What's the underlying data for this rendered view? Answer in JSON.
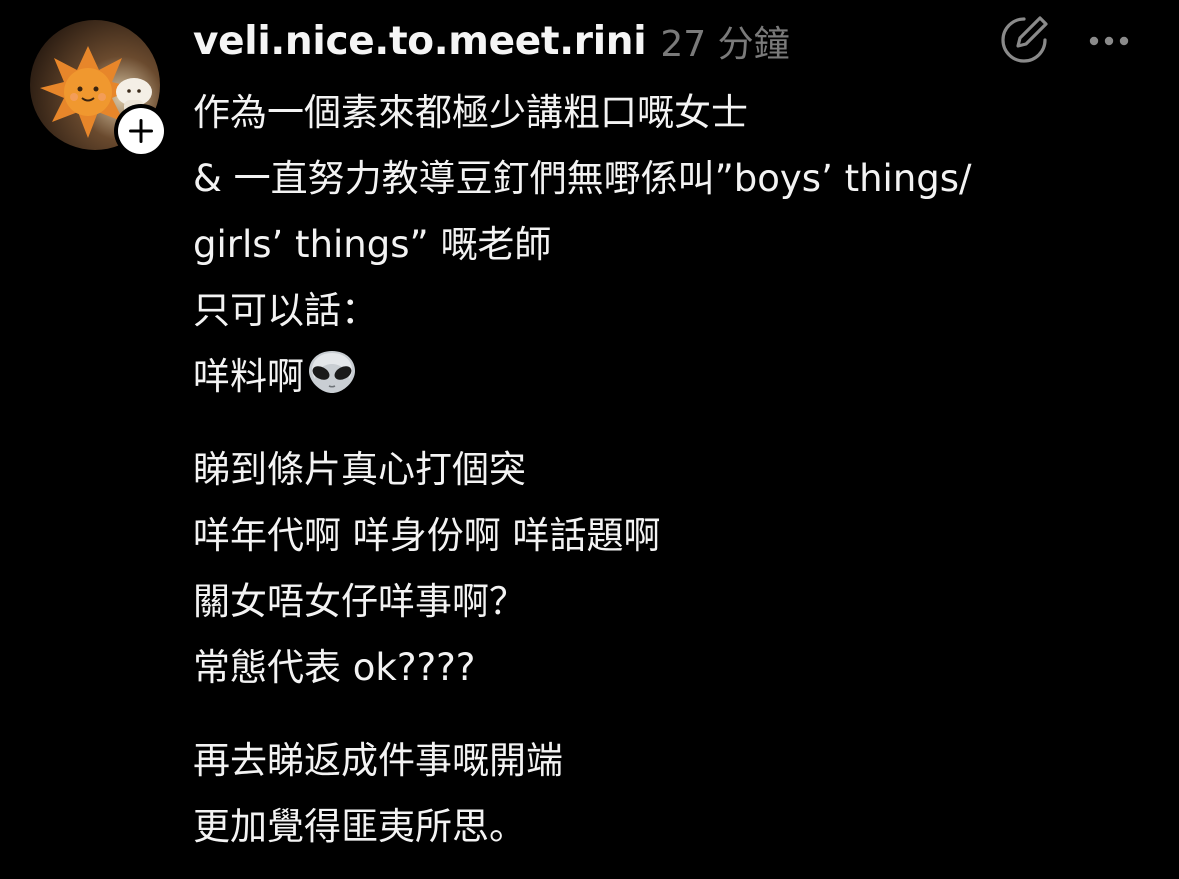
{
  "post": {
    "username": "veli.nice.to.meet.rini",
    "timestamp": "27 分鐘",
    "paragraphs": [
      [
        "作為一個素來都極少講粗口嘅女士",
        "& 一直努力教導豆釘們無嘢係叫”boys’ things/",
        "girls’ things” 嘅老師",
        "只可以話：",
        "咩料啊"
      ],
      [
        "睇到條片真心打個突",
        "咩年代啊 咩身份啊 咩話題啊",
        "關女唔女仔咩事啊？",
        "常態代表 ok????"
      ],
      [
        "再去睇返成件事嘅開端",
        "更加覺得匪夷所思。"
      ]
    ]
  },
  "icons": {
    "avatar": "avatar-plush-sun",
    "follow": "plus-icon",
    "compose": "compose-icon",
    "more": "more-icon",
    "emoji": "alien-emoji"
  },
  "colors": {
    "background": "#000000",
    "text": "#f3f3f3",
    "muted": "#7a7a7a",
    "icon": "#8a8a8a"
  }
}
